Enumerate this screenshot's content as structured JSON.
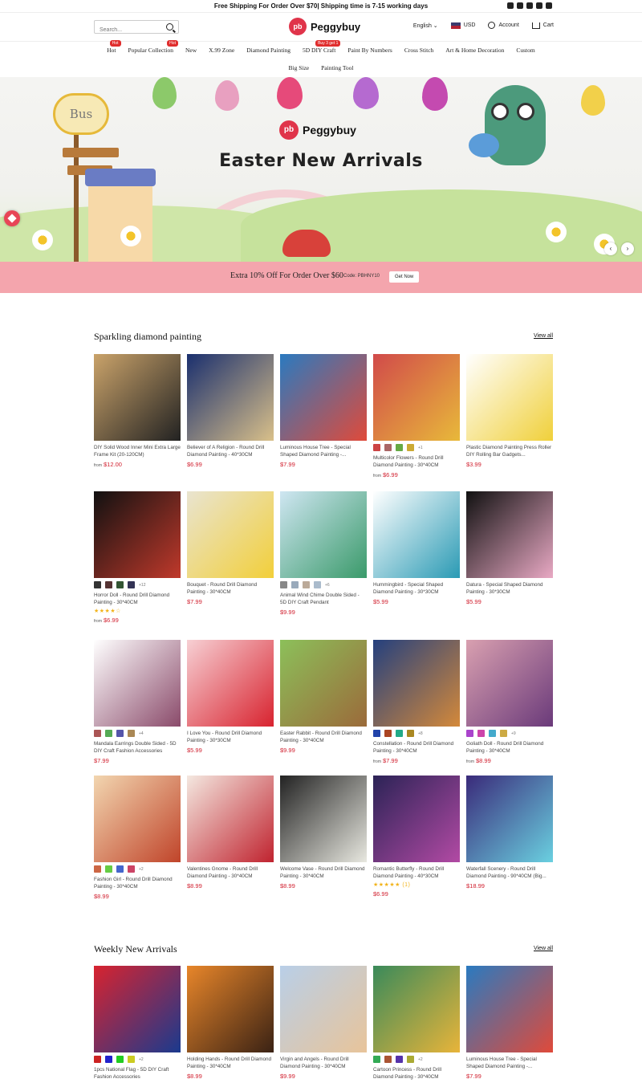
{
  "topbar": {
    "message": "Free Shipping For Order Over $70| Shipping time is 7-15 working days",
    "social": [
      "instagram-icon",
      "facebook-icon",
      "youtube-icon",
      "twitter-icon",
      "pinterest-icon"
    ]
  },
  "header": {
    "search_placeholder": "Search...",
    "logo_badge": "pb",
    "logo_text": "Peggybuy",
    "language": "English ⌄",
    "currency": "USD",
    "account": "Account",
    "cart": "Cart"
  },
  "nav": {
    "row1": [
      {
        "label": "Hot",
        "tag": "Hot"
      },
      {
        "label": "Popular Collection",
        "tag": "Hot"
      },
      {
        "label": "New",
        "tag": ""
      },
      {
        "label": "X.99 Zone",
        "tag": ""
      },
      {
        "label": "Diamond Painting",
        "tag": ""
      },
      {
        "label": "5D DIY Craft",
        "tag": "Buy 3 get 1"
      },
      {
        "label": "Paint By Numbers",
        "tag": ""
      },
      {
        "label": "Cross Stitch",
        "tag": ""
      },
      {
        "label": "Art & Home Decoration",
        "tag": ""
      },
      {
        "label": "Custom",
        "tag": ""
      }
    ],
    "row2": [
      {
        "label": "Big Size",
        "tag": ""
      },
      {
        "label": "Painting Tool",
        "tag": ""
      }
    ]
  },
  "hero": {
    "logo_badge": "pb",
    "logo_text": "Peggybuy",
    "title": "Easter New Arrivals",
    "sign_text": "Bus",
    "prev": "‹",
    "next": "›"
  },
  "promo": {
    "text": "Extra 10% Off For Order Over $60",
    "code": "Code: PBHNY10",
    "button": "Get Now"
  },
  "sections": [
    {
      "title": "Sparkling diamond painting",
      "view_all": "View all",
      "products": [
        {
          "title": "DIY Solid Wood Inner Mini Extra Large Frame Kit (20-120CM)",
          "price": "$12.00",
          "from": true,
          "colors": [
            "#caa36a",
            "#222222"
          ],
          "swatches": [],
          "more": "",
          "stars": ""
        },
        {
          "title": "Believer of A Religion - Round Drill Diamond Painting - 40*30CM",
          "price": "$6.99",
          "from": false,
          "colors": [
            "#1a2f6e",
            "#d9c08a"
          ],
          "swatches": [],
          "more": "",
          "stars": ""
        },
        {
          "title": "Luminous House Tree - Special Shaped Diamond Painting -...",
          "price": "$7.99",
          "from": false,
          "colors": [
            "#2a7ac0",
            "#e04a3a"
          ],
          "swatches": [],
          "more": "",
          "stars": ""
        },
        {
          "title": "Multicolor Flowers - Round Drill Diamond Painting - 30*40CM",
          "price": "$6.99",
          "from": true,
          "colors": [
            "#d14a4a",
            "#e8b93a"
          ],
          "swatches": [
            "#c44",
            "#a66",
            "#6a4",
            "#ca3"
          ],
          "more": "+1",
          "stars": ""
        },
        {
          "title": "Plastic Diamond Painting Press Roller DIY Rolling Bar Gadgets...",
          "price": "$3.99",
          "from": false,
          "colors": [
            "#ffffff",
            "#f0d03a"
          ],
          "swatches": [],
          "more": "",
          "stars": ""
        },
        {
          "title": "Horror Doll - Round Drill Diamond Painting - 30*40CM",
          "price": "$6.99",
          "from": true,
          "colors": [
            "#111111",
            "#c0392b"
          ],
          "swatches": [
            "#333",
            "#533",
            "#353",
            "#335"
          ],
          "more": "+12",
          "stars": "★★★★☆"
        },
        {
          "title": "Bouquet - Round Drill Diamond Painting - 30*40CM",
          "price": "$7.99",
          "from": false,
          "colors": [
            "#e9e4d0",
            "#f2cf3a"
          ],
          "swatches": [],
          "more": "",
          "stars": ""
        },
        {
          "title": "Animal Wind Chime Double Sided - 5D DIY Craft Pendant",
          "price": "$9.99",
          "from": false,
          "colors": [
            "#cfe6f2",
            "#3a9a6a"
          ],
          "swatches": [
            "#888",
            "#9ab",
            "#ba9",
            "#abc"
          ],
          "more": "+6",
          "stars": ""
        },
        {
          "title": "Hummingbird - Special Shaped Diamond Painting - 30*30CM",
          "price": "$5.99",
          "from": false,
          "colors": [
            "#ffffff",
            "#2a9ab4"
          ],
          "swatches": [],
          "more": "",
          "stars": ""
        },
        {
          "title": "Datura - Special Shaped Diamond Painting - 30*30CM",
          "price": "$5.99",
          "from": false,
          "colors": [
            "#111111",
            "#e9a9c4"
          ],
          "swatches": [],
          "more": "",
          "stars": ""
        },
        {
          "title": "Mandala Earrings Double Sided - 5D DIY Craft Fashion Accessories",
          "price": "$7.99",
          "from": false,
          "colors": [
            "#ffffff",
            "#8a4a6a"
          ],
          "swatches": [
            "#a55",
            "#5a5",
            "#55a",
            "#a85"
          ],
          "more": "+4",
          "stars": ""
        },
        {
          "title": "I Love You - Round Drill Diamond Painting - 30*30CM",
          "price": "$5.99",
          "from": false,
          "colors": [
            "#f7d0d4",
            "#d8232f"
          ],
          "swatches": [],
          "more": "",
          "stars": ""
        },
        {
          "title": "Easter Rabbit - Round Drill Diamond Painting - 30*40CM",
          "price": "$9.99",
          "from": false,
          "colors": [
            "#8cc05a",
            "#9b6a3a"
          ],
          "swatches": [],
          "more": "",
          "stars": ""
        },
        {
          "title": "Constellation - Round Drill Diamond Painting - 30*40CM",
          "price": "$7.99",
          "from": true,
          "colors": [
            "#24407e",
            "#d4893a"
          ],
          "swatches": [
            "#24a",
            "#a42",
            "#2a8",
            "#a82"
          ],
          "more": "+8",
          "stars": ""
        },
        {
          "title": "Goliath Doll - Round Drill Diamond Painting - 30*40CM",
          "price": "$8.99",
          "from": true,
          "colors": [
            "#d9a0b0",
            "#6a3a7a"
          ],
          "swatches": [
            "#a4c",
            "#c4a",
            "#4ac",
            "#ca4"
          ],
          "more": "+9",
          "stars": ""
        },
        {
          "title": "Fashion Girl - Round Drill Diamond Painting - 30*40CM",
          "price": "$8.99",
          "from": false,
          "colors": [
            "#f2d6b0",
            "#c0442a"
          ],
          "swatches": [
            "#c64",
            "#6c4",
            "#46c",
            "#c46"
          ],
          "more": "+2",
          "stars": ""
        },
        {
          "title": "Valentines Gnome - Round Drill Diamond Painting - 30*40CM",
          "price": "$8.99",
          "from": false,
          "colors": [
            "#f4e8e0",
            "#c0232f"
          ],
          "swatches": [],
          "more": "",
          "stars": ""
        },
        {
          "title": "Welcome Vase - Round Drill Diamond Painting - 30*40CM",
          "price": "$8.99",
          "from": false,
          "colors": [
            "#222222",
            "#e8e8e0"
          ],
          "swatches": [],
          "more": "",
          "stars": ""
        },
        {
          "title": "Romantic Butterfly - Round Drill Diamond Painting - 40*30CM",
          "price": "$6.99",
          "from": false,
          "colors": [
            "#2b2356",
            "#b24aa4"
          ],
          "swatches": [],
          "more": "",
          "stars": "★★★★★ (1)"
        },
        {
          "title": "Waterfall Scenery - Round Drill Diamond Painting - 90*40CM (Big...",
          "price": "$18.99",
          "from": false,
          "colors": [
            "#3a2a7a",
            "#6ad0e0"
          ],
          "swatches": [],
          "more": "",
          "stars": ""
        }
      ]
    },
    {
      "title": "Weekly New Arrivals",
      "view_all": "View all",
      "products": [
        {
          "title": "1pcs National Flag - 5D DIY Craft Fashion Accessories",
          "price": "",
          "from": false,
          "colors": [
            "#d8232f",
            "#1a3a8e"
          ],
          "swatches": [
            "#c22",
            "#22c",
            "#2c2",
            "#cc2"
          ],
          "more": "+2",
          "stars": ""
        },
        {
          "title": "Holding Hands - Round Drill Diamond Painting - 30*40CM",
          "price": "$8.99",
          "from": false,
          "colors": [
            "#e8862a",
            "#3a2214"
          ],
          "swatches": [],
          "more": "",
          "stars": ""
        },
        {
          "title": "Virgin and Angels - Round Drill Diamond Painting - 30*40CM",
          "price": "$9.99",
          "from": false,
          "colors": [
            "#b9cfe8",
            "#e8c49a"
          ],
          "swatches": [],
          "more": "",
          "stars": ""
        },
        {
          "title": "Cartoon Princess - Round Drill Diamond Painting - 30*40CM",
          "price": "",
          "from": false,
          "colors": [
            "#3a8a5a",
            "#e8b43a"
          ],
          "swatches": [
            "#3a5",
            "#a53",
            "#53a",
            "#aa3"
          ],
          "more": "+2",
          "stars": ""
        },
        {
          "title": "Luminous House Tree - Special Shaped Diamond Painting -...",
          "price": "$7.99",
          "from": false,
          "colors": [
            "#2a7ac0",
            "#e04a3a"
          ],
          "swatches": [],
          "more": "",
          "stars": ""
        }
      ]
    }
  ]
}
